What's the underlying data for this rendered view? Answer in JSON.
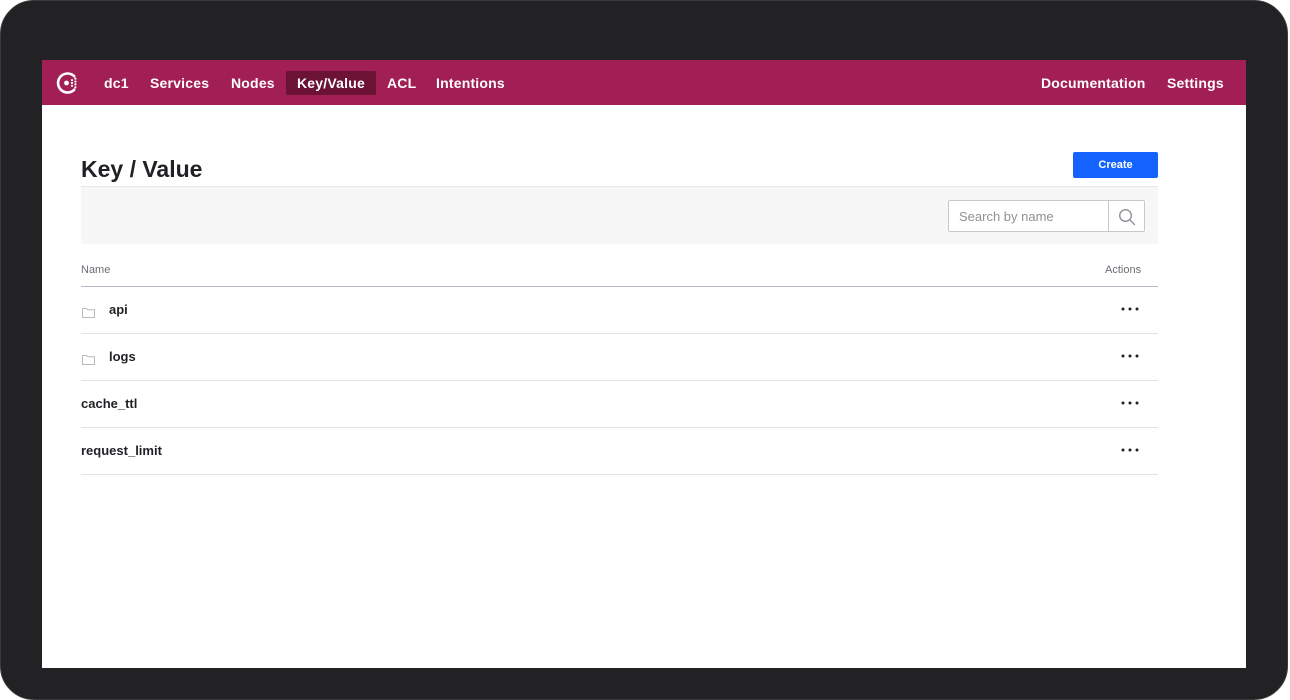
{
  "nav": {
    "datacenter": "dc1",
    "items": [
      {
        "label": "Services"
      },
      {
        "label": "Nodes"
      },
      {
        "label": "Key/Value",
        "active": true
      },
      {
        "label": "ACL"
      },
      {
        "label": "Intentions"
      }
    ],
    "right": [
      {
        "label": "Documentation"
      },
      {
        "label": "Settings"
      }
    ],
    "logo_icon": "consul-logo-icon",
    "brand_color": "#a11f55",
    "active_color": "#6b1235"
  },
  "page": {
    "title": "Key / Value",
    "create_label": "Create",
    "create_color": "#1563ff"
  },
  "search": {
    "placeholder": "Search by name",
    "value": "",
    "icon": "search-icon"
  },
  "table": {
    "columns": {
      "name": "Name",
      "actions": "Actions"
    },
    "rows": [
      {
        "name": "api",
        "type": "folder",
        "icon": "folder-icon",
        "actions_icon": "more-dots-icon"
      },
      {
        "name": "logs",
        "type": "folder",
        "icon": "folder-icon",
        "actions_icon": "more-dots-icon"
      },
      {
        "name": "cache_ttl",
        "type": "key",
        "actions_icon": "more-dots-icon"
      },
      {
        "name": "request_limit",
        "type": "key",
        "actions_icon": "more-dots-icon"
      }
    ]
  }
}
